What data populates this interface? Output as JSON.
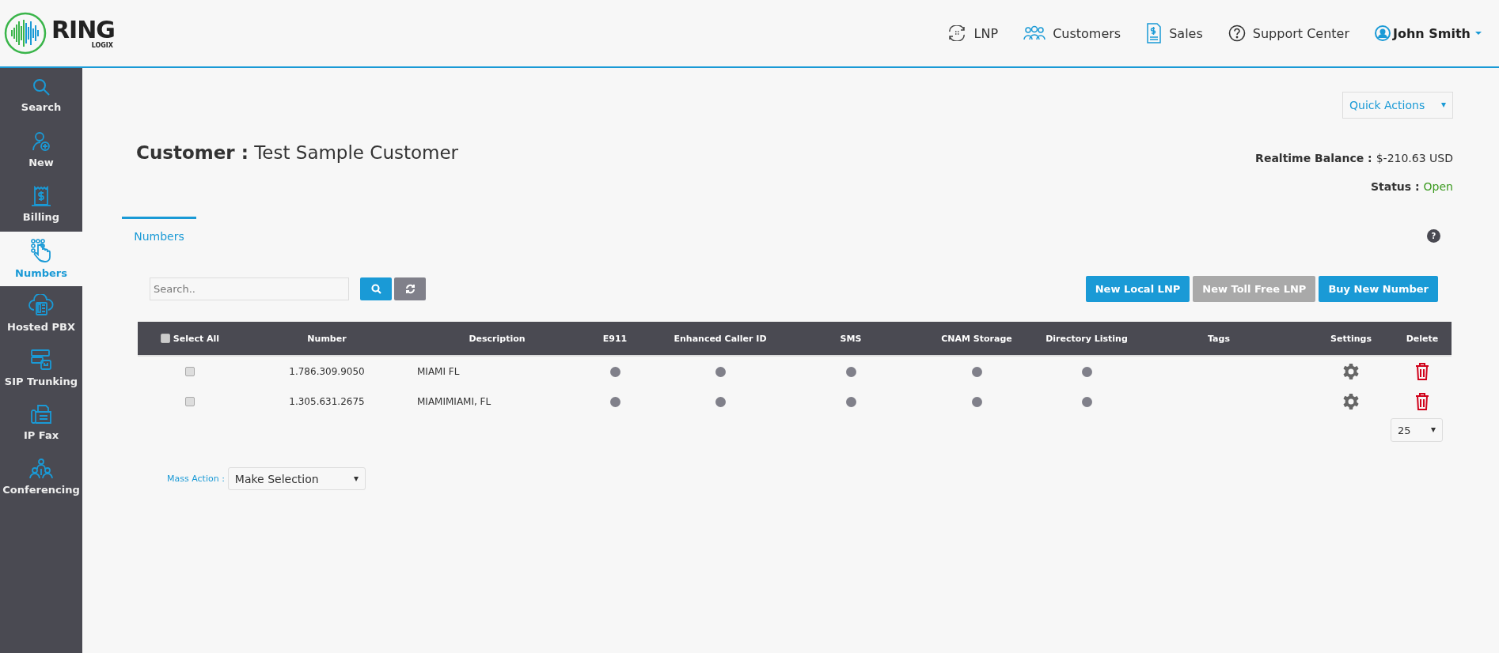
{
  "header": {
    "logo": {
      "word": "RING",
      "sub": "LOGIX"
    },
    "nav": [
      {
        "kind": "lnp",
        "label": "LNP"
      },
      {
        "kind": "customers",
        "label": "Customers"
      },
      {
        "kind": "sales",
        "label": "Sales"
      },
      {
        "kind": "support",
        "label": "Support Center"
      }
    ],
    "user": {
      "name": "John Smith"
    }
  },
  "sidebar": {
    "items": [
      {
        "kind": "search",
        "label": "Search",
        "selected": false
      },
      {
        "kind": "new",
        "label": "New",
        "selected": false
      },
      {
        "kind": "billing",
        "label": "Billing",
        "selected": false
      },
      {
        "kind": "numbers",
        "label": "Numbers",
        "selected": true
      },
      {
        "kind": "pbx",
        "label": "Hosted PBX",
        "selected": false
      },
      {
        "kind": "sip",
        "label": "SIP Trunking",
        "selected": false
      },
      {
        "kind": "fax",
        "label": "IP Fax",
        "selected": false
      },
      {
        "kind": "conf",
        "label": "Conferencing",
        "selected": false
      }
    ]
  },
  "quick_actions": {
    "label": "Quick Actions"
  },
  "customer": {
    "label": "Customer :",
    "name": "Test Sample Customer"
  },
  "balance": {
    "label": "Realtime Balance :",
    "value": "$-210.63 USD"
  },
  "status": {
    "label": "Status :",
    "value": "Open"
  },
  "tabs": [
    {
      "label": "Numbers",
      "selected": true
    }
  ],
  "help": {
    "label": "?"
  },
  "search": {
    "placeholder": "Search.."
  },
  "actions": [
    {
      "label": "New Local LNP",
      "disabled": false
    },
    {
      "label": "New Toll Free LNP",
      "disabled": true
    },
    {
      "label": "Buy New Number",
      "disabled": false
    }
  ],
  "table": {
    "select_all": {
      "label": "Select All",
      "checked": false
    },
    "columns": [
      "Number",
      "Description",
      "E911",
      "Enhanced Caller ID",
      "SMS",
      "CNAM Storage",
      "Directory Listing",
      "Tags",
      "Settings",
      "Delete"
    ],
    "rows": [
      {
        "checked": false,
        "number": "1.786.309.9050",
        "description": "MIAMI FL",
        "features": [
          false,
          false,
          false,
          false,
          false
        ]
      },
      {
        "checked": false,
        "number": "1.305.631.2675",
        "description": "MIAMIMIAMI, FL",
        "features": [
          false,
          false,
          false,
          false,
          false
        ]
      }
    ]
  },
  "page_size": {
    "value": "25"
  },
  "mass_action": {
    "label": "Mass Action :",
    "value": "Make Selection"
  }
}
